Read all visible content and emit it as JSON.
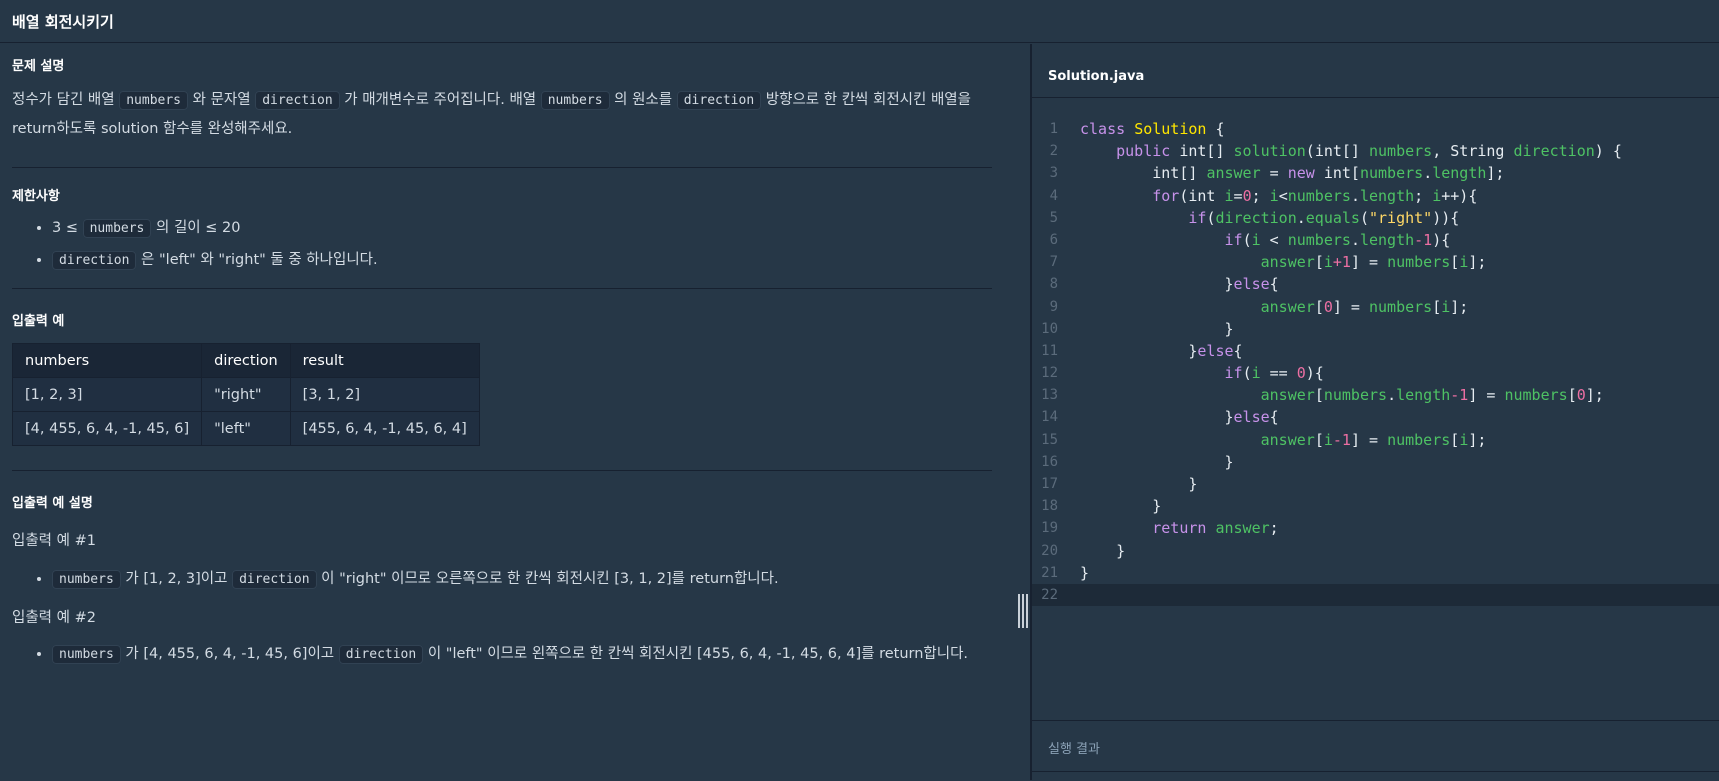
{
  "page": {
    "title": "배열 회전시키기"
  },
  "problem": {
    "desc_heading": "문제 설명",
    "desc": {
      "t1": "정수가 담긴 배열 ",
      "c1": "numbers",
      "t2": " 와 문자열 ",
      "c2": "direction",
      "t3": " 가 매개변수로 주어집니다. 배열 ",
      "c3": "numbers",
      "t4": " 의 원소를 ",
      "c4": "direction",
      "t5": " 방향으로 한 칸씩 회전시킨 배열을 return하도록 solution 함수를 완성해주세요."
    },
    "constraints_heading": "제한사항",
    "constraints": [
      {
        "pre": "3 ≤ ",
        "code": "numbers",
        "post": " 의 길이 ≤ 20"
      },
      {
        "pre": "",
        "code": "direction",
        "post": " 은 \"left\" 와 \"right\" 둘 중 하나입니다."
      }
    ],
    "io_heading": "입출력 예",
    "io_table": {
      "headers": [
        "numbers",
        "direction",
        "result"
      ],
      "rows": [
        [
          "[1, 2, 3]",
          "\"right\"",
          "[3, 1, 2]"
        ],
        [
          "[4, 455, 6, 4, -1, 45, 6]",
          "\"left\"",
          "[455, 6, 4, -1, 45, 6, 4]"
        ]
      ]
    },
    "explain_heading": "입출력 예 설명",
    "ex1_title": "입출력 예 #1",
    "ex1": {
      "code1": "numbers",
      "t1": " 가 [1, 2, 3]이고 ",
      "code2": "direction",
      "t2": " 이 \"right\" 이므로 오른쪽으로 한 칸씩 회전시킨 [3, 1, 2]를 return합니다."
    },
    "ex2_title": "입출력 예 #2",
    "ex2": {
      "code1": "numbers",
      "t1": " 가 [4, 455, 6, 4, -1, 45, 6]이고 ",
      "code2": "direction",
      "t2": " 이 \"left\" 이므로 왼쪽으로 한 칸씩 회전시킨 [455, 6, 4, -1, 45, 6, 4]를 return합니다."
    }
  },
  "editor": {
    "filename": "Solution.java",
    "line_numbers": [
      "1",
      "2",
      "3",
      "4",
      "5",
      "6",
      "7",
      "8",
      "9",
      "10",
      "11",
      "12",
      "13",
      "14",
      "15",
      "16",
      "17",
      "18",
      "19",
      "20",
      "21",
      "22"
    ],
    "tokens": {
      "class": "class",
      "Solution": "Solution",
      "brace_open": " {",
      "public": "public",
      "intarr": "int[]",
      "solution": "solution",
      "paren": "(",
      "intarr2": "int[]",
      "numbers": "numbers",
      "comma": ", ",
      "String": "String",
      "direction": "direction",
      "close_sig": ") {",
      "answer": "answer",
      "eq_new": " = ",
      "new": "new",
      "int_len": " int[",
      "numbers_len": "numbers",
      "dot": ".",
      "length": "length",
      "end3": "];",
      "for": "for",
      "for_open": "(",
      "int": "int",
      "i": "i",
      "eq0": "=",
      "zero": "0",
      "semi": "; ",
      "lt": "<",
      "pp": "++){",
      "if": "if",
      "equals": "equals",
      "right": "\"right\"",
      "close_if": ")){",
      "lt_sp": " < ",
      "minus1": "-1",
      "close_brace": "){",
      "lb": "[",
      "plus1": "+1",
      "rb": "]",
      "assign": " = ",
      "end": "];",
      "else_close": "}",
      "else": "else",
      "else_open": "{",
      "eqeq": " == ",
      "return": "return",
      "semi_end": ";",
      "close": "}"
    }
  },
  "result": {
    "label": "실행 결과"
  }
}
